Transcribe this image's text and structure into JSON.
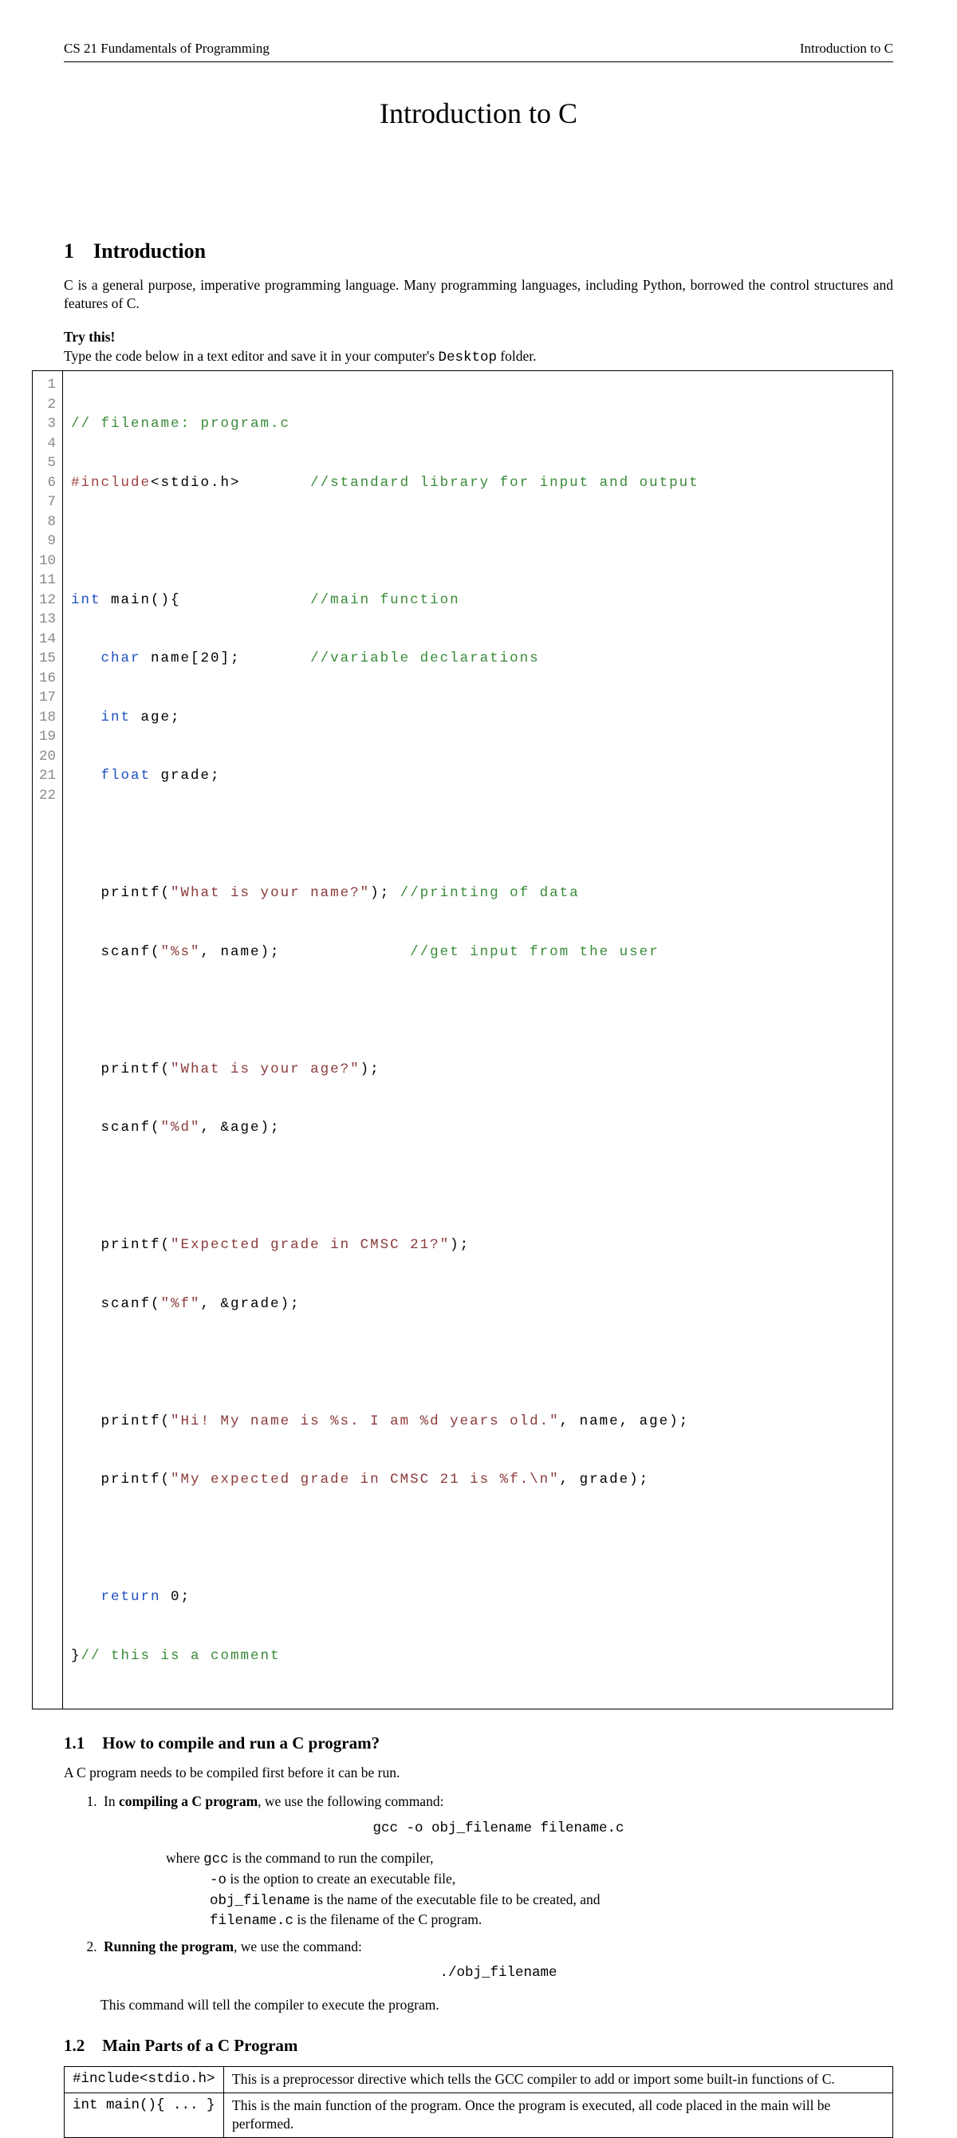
{
  "header": {
    "left": "CS 21 Fundamentals of Programming",
    "right": "Introduction to C"
  },
  "title": "Introduction to C",
  "s1": {
    "num": "1",
    "heading": "Introduction",
    "para1a": "C is a general purpose, imperative programming language.  Many programming languages, including Python, borrowed the control structures and features of C.",
    "try": "Try this!",
    "try_text_a": "Type the code below in a text editor and save it in your computer's ",
    "try_text_b": "Desktop",
    "try_text_c": " folder."
  },
  "code": {
    "lines": 22,
    "l1_comment": "// filename: program.c",
    "l2_pre": "#include",
    "l2_rest": "<stdio.h>",
    "l2_cmt": "//standard library for input and output",
    "l4_kw": "int",
    "l4_rest": " main(){",
    "l4_cmt": "//main function",
    "l5_kw": "char",
    "l5_rest": " name[20];",
    "l5_cmt": "//variable declarations",
    "l6_kw": "int",
    "l6_rest": " age;",
    "l7_kw": "float",
    "l7_rest": " grade;",
    "l9_a": "   printf(",
    "l9_s": "\"What is your name?\"",
    "l9_b": "); ",
    "l9_cmt": "//printing of data",
    "l10_a": "   scanf(",
    "l10_s": "\"%s\"",
    "l10_b": ", name);",
    "l10_cmt": "//get input from the user",
    "l12_a": "   printf(",
    "l12_s": "\"What is your age?\"",
    "l12_b": ");",
    "l13_a": "   scanf(",
    "l13_s": "\"%d\"",
    "l13_b": ", &age);",
    "l15_a": "   printf(",
    "l15_s": "\"Expected grade in CMSC 21?\"",
    "l15_b": ");",
    "l16_a": "   scanf(",
    "l16_s": "\"%f\"",
    "l16_b": ", &grade);",
    "l18_a": "   printf(",
    "l18_s": "\"Hi! My name is %s. I am %d years old.\"",
    "l18_b": ", name, age);",
    "l19_a": "   printf(",
    "l19_s": "\"My expected grade in CMSC 21 is %f.\\n\"",
    "l19_b": ", grade);",
    "l21_kw": "return",
    "l21_rest": " 0;",
    "l22_a": "}",
    "l22_cmt": "// this is a comment"
  },
  "s11": {
    "num": "1.1",
    "heading": "How to compile and run a C program?",
    "intro": "A C program needs to be compiled first before it can be run.",
    "li1_a": "In ",
    "li1_b": "compiling a C program",
    "li1_c": ", we use the following command:",
    "cmd1": "gcc -o obj_filename filename.c",
    "where1_a": "where ",
    "where1_b": "gcc",
    "where1_c": " is the command to run the compiler,",
    "where2_a": "-o",
    "where2_b": " is the option to create an executable file,",
    "where3_a": "obj_filename",
    "where3_b": " is the name of the executable file to be created, and",
    "where4_a": "filename.c",
    "where4_b": " is the filename of the C program.",
    "li2_a": "Running the program",
    "li2_b": ", we use the command:",
    "cmd2": "./obj_filename",
    "closing": "This command will tell the compiler to execute the program."
  },
  "s12": {
    "num": "1.2",
    "heading": "Main Parts of a C Program",
    "rows": [
      {
        "k": "#include<stdio.h>",
        "v": "This is a preprocessor directive which tells the GCC compiler to add or import some built-in functions of C."
      },
      {
        "k": "int main(){ ... }",
        "v": "This is the main function of the program. Once the program is executed, all code placed in the main will be performed."
      }
    ]
  }
}
